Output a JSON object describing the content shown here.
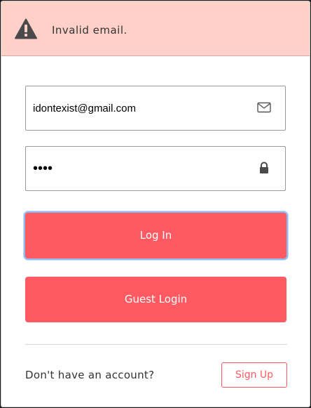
{
  "alert": {
    "icon": "warning-icon",
    "message": "Invalid email."
  },
  "email": {
    "value": "idontexist@gmail.com",
    "icon": "envelope-icon"
  },
  "password": {
    "value": "abcd",
    "icon": "lock-icon"
  },
  "buttons": {
    "login_label": "Log In",
    "guest_label": "Guest Login"
  },
  "footer": {
    "prompt": "Don't have an account?",
    "signup_label": "Sign Up"
  },
  "colors": {
    "accent": "#ff5a61",
    "alert_bg": "#ffd0c8"
  }
}
